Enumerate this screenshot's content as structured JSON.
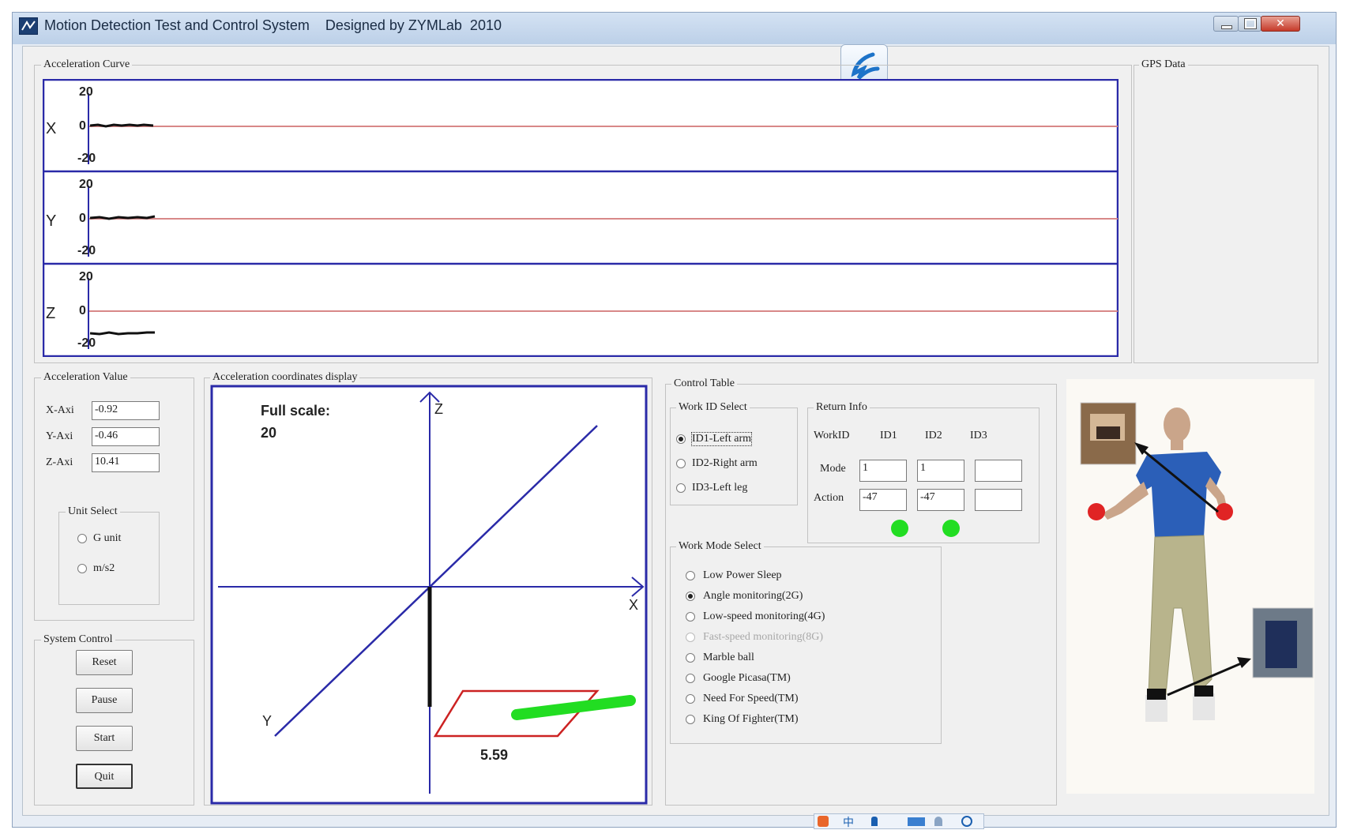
{
  "window": {
    "title": "Motion Detection Test and Control System    Designed by ZYMLab  2010",
    "controls": [
      "minimize-icon",
      "maximize-icon",
      "close-icon"
    ]
  },
  "acceleration_curve": {
    "label": "Acceleration Curve",
    "axes": [
      {
        "name": "X",
        "top_tick": "20",
        "zero_tick": "0",
        "bottom_tick": "-20"
      },
      {
        "name": "Y",
        "top_tick": "20",
        "zero_tick": "0",
        "bottom_tick": "-20"
      },
      {
        "name": "Z",
        "top_tick": "20",
        "zero_tick": "0",
        "bottom_tick": "-20"
      }
    ]
  },
  "gps": {
    "label": "GPS Data"
  },
  "acceleration_value": {
    "label": "Acceleration Value",
    "rows": [
      {
        "label": "X-Axi",
        "value": "-0.92"
      },
      {
        "label": "Y-Axi",
        "value": "-0.46"
      },
      {
        "label": "Z-Axi",
        "value": "10.41"
      }
    ],
    "unit_select": {
      "label": "Unit Select",
      "options": [
        {
          "label": "G unit",
          "selected": false
        },
        {
          "label": "m/s2",
          "selected": false
        }
      ]
    }
  },
  "system_control": {
    "label": "System Control",
    "buttons": [
      "Reset",
      "Pause",
      "Start",
      "Quit"
    ]
  },
  "coord_display": {
    "label": "Acceleration coordinates display",
    "full_scale_label": "Full scale:",
    "full_scale_value": "20",
    "axis_z": "Z",
    "axis_x": "X",
    "axis_y": "Y",
    "magnitude": "5.59"
  },
  "control_table": {
    "label": "Control Table",
    "work_id_select": {
      "label": "Work ID Select",
      "options": [
        {
          "label": "ID1-Left arm",
          "selected": true
        },
        {
          "label": "ID2-Right arm",
          "selected": false
        },
        {
          "label": "ID3-Left leg",
          "selected": false
        }
      ]
    },
    "return_info": {
      "label": "Return Info",
      "headers": [
        "WorkID",
        "ID1",
        "ID2",
        "ID3"
      ],
      "mode_label": "Mode",
      "mode_values": [
        "1",
        "1",
        ""
      ],
      "action_label": "Action",
      "action_values": [
        "-47",
        "-47",
        ""
      ],
      "status_color": "#22dd22"
    },
    "work_mode_select": {
      "label": "Work Mode Select",
      "options": [
        {
          "label": "Low Power Sleep",
          "selected": false,
          "enabled": true
        },
        {
          "label": "Angle monitoring(2G)",
          "selected": true,
          "enabled": true
        },
        {
          "label": "Low-speed monitoring(4G)",
          "selected": false,
          "enabled": true
        },
        {
          "label": "Fast-speed monitoring(8G)",
          "selected": false,
          "enabled": false
        },
        {
          "label": "Marble ball",
          "selected": false,
          "enabled": true
        },
        {
          "label": "Google Picasa(TM)",
          "selected": false,
          "enabled": true
        },
        {
          "label": "Need For Speed(TM)",
          "selected": false,
          "enabled": true
        },
        {
          "label": "King Of Fighter(TM)",
          "selected": false,
          "enabled": true
        }
      ]
    }
  },
  "taskbar": {
    "icons": [
      "sogou-icon",
      "chinese-input-icon",
      "punctuation-icon",
      "keyboard-icon",
      "user-icon",
      "tool-icon"
    ],
    "ime_text": "中"
  },
  "colors": {
    "curve_frame": "#2a2aa8",
    "zero_line": "#d88888",
    "axis": "#2a2aa8",
    "plane": "#cc2222",
    "vector": "#22dd22"
  }
}
